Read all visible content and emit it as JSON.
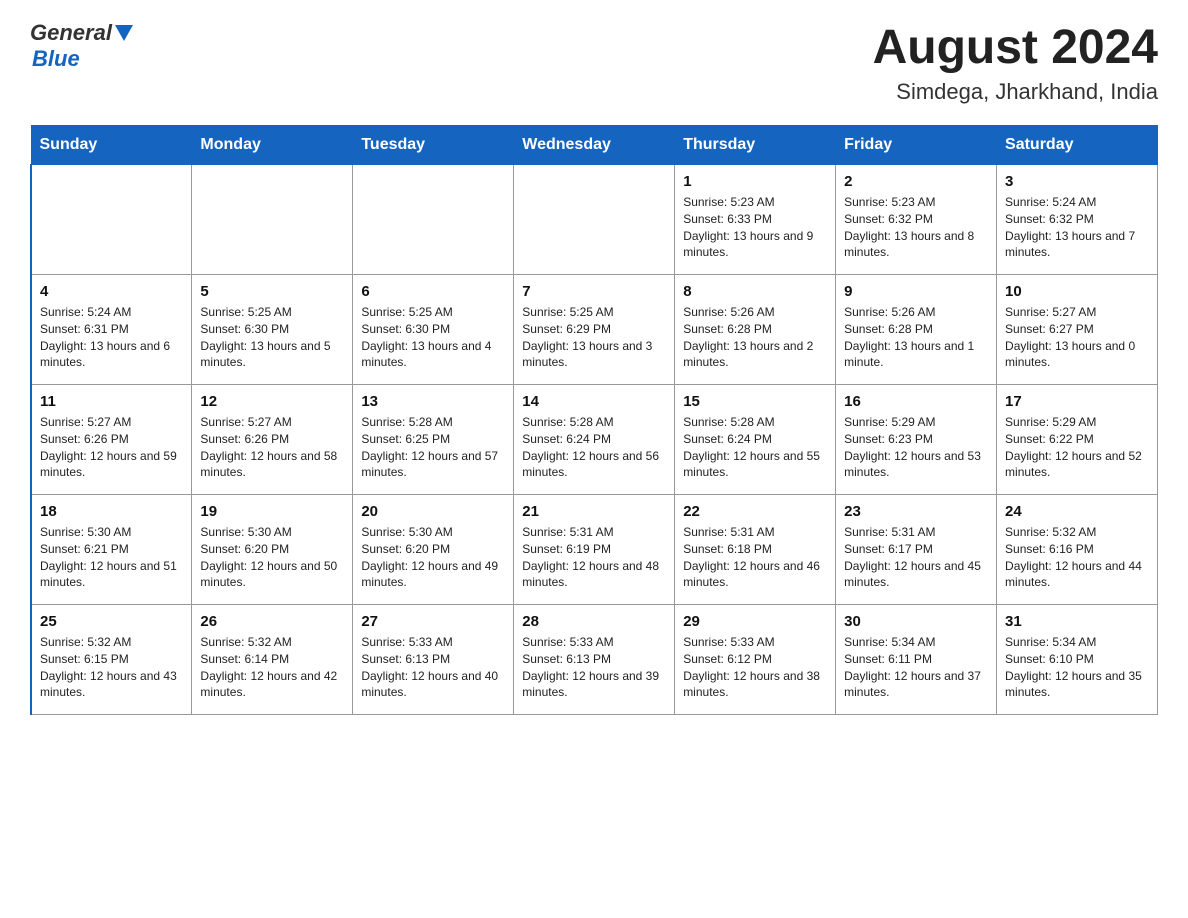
{
  "header": {
    "logo_general": "General",
    "logo_blue": "Blue",
    "month_year": "August 2024",
    "location": "Simdega, Jharkhand, India"
  },
  "days_of_week": [
    "Sunday",
    "Monday",
    "Tuesday",
    "Wednesday",
    "Thursday",
    "Friday",
    "Saturday"
  ],
  "weeks": [
    [
      {
        "day": "",
        "info": ""
      },
      {
        "day": "",
        "info": ""
      },
      {
        "day": "",
        "info": ""
      },
      {
        "day": "",
        "info": ""
      },
      {
        "day": "1",
        "info": "Sunrise: 5:23 AM\nSunset: 6:33 PM\nDaylight: 13 hours and 9 minutes."
      },
      {
        "day": "2",
        "info": "Sunrise: 5:23 AM\nSunset: 6:32 PM\nDaylight: 13 hours and 8 minutes."
      },
      {
        "day": "3",
        "info": "Sunrise: 5:24 AM\nSunset: 6:32 PM\nDaylight: 13 hours and 7 minutes."
      }
    ],
    [
      {
        "day": "4",
        "info": "Sunrise: 5:24 AM\nSunset: 6:31 PM\nDaylight: 13 hours and 6 minutes."
      },
      {
        "day": "5",
        "info": "Sunrise: 5:25 AM\nSunset: 6:30 PM\nDaylight: 13 hours and 5 minutes."
      },
      {
        "day": "6",
        "info": "Sunrise: 5:25 AM\nSunset: 6:30 PM\nDaylight: 13 hours and 4 minutes."
      },
      {
        "day": "7",
        "info": "Sunrise: 5:25 AM\nSunset: 6:29 PM\nDaylight: 13 hours and 3 minutes."
      },
      {
        "day": "8",
        "info": "Sunrise: 5:26 AM\nSunset: 6:28 PM\nDaylight: 13 hours and 2 minutes."
      },
      {
        "day": "9",
        "info": "Sunrise: 5:26 AM\nSunset: 6:28 PM\nDaylight: 13 hours and 1 minute."
      },
      {
        "day": "10",
        "info": "Sunrise: 5:27 AM\nSunset: 6:27 PM\nDaylight: 13 hours and 0 minutes."
      }
    ],
    [
      {
        "day": "11",
        "info": "Sunrise: 5:27 AM\nSunset: 6:26 PM\nDaylight: 12 hours and 59 minutes."
      },
      {
        "day": "12",
        "info": "Sunrise: 5:27 AM\nSunset: 6:26 PM\nDaylight: 12 hours and 58 minutes."
      },
      {
        "day": "13",
        "info": "Sunrise: 5:28 AM\nSunset: 6:25 PM\nDaylight: 12 hours and 57 minutes."
      },
      {
        "day": "14",
        "info": "Sunrise: 5:28 AM\nSunset: 6:24 PM\nDaylight: 12 hours and 56 minutes."
      },
      {
        "day": "15",
        "info": "Sunrise: 5:28 AM\nSunset: 6:24 PM\nDaylight: 12 hours and 55 minutes."
      },
      {
        "day": "16",
        "info": "Sunrise: 5:29 AM\nSunset: 6:23 PM\nDaylight: 12 hours and 53 minutes."
      },
      {
        "day": "17",
        "info": "Sunrise: 5:29 AM\nSunset: 6:22 PM\nDaylight: 12 hours and 52 minutes."
      }
    ],
    [
      {
        "day": "18",
        "info": "Sunrise: 5:30 AM\nSunset: 6:21 PM\nDaylight: 12 hours and 51 minutes."
      },
      {
        "day": "19",
        "info": "Sunrise: 5:30 AM\nSunset: 6:20 PM\nDaylight: 12 hours and 50 minutes."
      },
      {
        "day": "20",
        "info": "Sunrise: 5:30 AM\nSunset: 6:20 PM\nDaylight: 12 hours and 49 minutes."
      },
      {
        "day": "21",
        "info": "Sunrise: 5:31 AM\nSunset: 6:19 PM\nDaylight: 12 hours and 48 minutes."
      },
      {
        "day": "22",
        "info": "Sunrise: 5:31 AM\nSunset: 6:18 PM\nDaylight: 12 hours and 46 minutes."
      },
      {
        "day": "23",
        "info": "Sunrise: 5:31 AM\nSunset: 6:17 PM\nDaylight: 12 hours and 45 minutes."
      },
      {
        "day": "24",
        "info": "Sunrise: 5:32 AM\nSunset: 6:16 PM\nDaylight: 12 hours and 44 minutes."
      }
    ],
    [
      {
        "day": "25",
        "info": "Sunrise: 5:32 AM\nSunset: 6:15 PM\nDaylight: 12 hours and 43 minutes."
      },
      {
        "day": "26",
        "info": "Sunrise: 5:32 AM\nSunset: 6:14 PM\nDaylight: 12 hours and 42 minutes."
      },
      {
        "day": "27",
        "info": "Sunrise: 5:33 AM\nSunset: 6:13 PM\nDaylight: 12 hours and 40 minutes."
      },
      {
        "day": "28",
        "info": "Sunrise: 5:33 AM\nSunset: 6:13 PM\nDaylight: 12 hours and 39 minutes."
      },
      {
        "day": "29",
        "info": "Sunrise: 5:33 AM\nSunset: 6:12 PM\nDaylight: 12 hours and 38 minutes."
      },
      {
        "day": "30",
        "info": "Sunrise: 5:34 AM\nSunset: 6:11 PM\nDaylight: 12 hours and 37 minutes."
      },
      {
        "day": "31",
        "info": "Sunrise: 5:34 AM\nSunset: 6:10 PM\nDaylight: 12 hours and 35 minutes."
      }
    ]
  ]
}
